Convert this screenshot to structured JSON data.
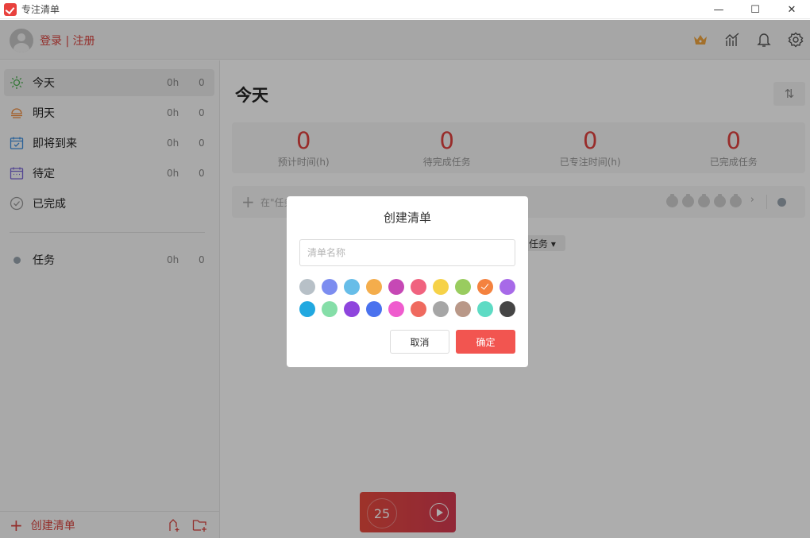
{
  "app": {
    "title": "专注清单"
  },
  "window_controls": {
    "minimize": "—",
    "maximize": "☐",
    "close": "✕"
  },
  "header": {
    "login": "登录",
    "separator": "|",
    "register": "注册"
  },
  "sidebar": {
    "items": [
      {
        "label": "今天",
        "hours": "0h",
        "count": "0",
        "icon": "sun-icon",
        "color": "#4caf50"
      },
      {
        "label": "明天",
        "hours": "0h",
        "count": "0",
        "icon": "sunset-icon",
        "color": "#f08a3a"
      },
      {
        "label": "即将到来",
        "hours": "0h",
        "count": "0",
        "icon": "calendar-check-icon",
        "color": "#3f8fe0"
      },
      {
        "label": "待定",
        "hours": "0h",
        "count": "0",
        "icon": "calendar-icon",
        "color": "#7b68d8"
      },
      {
        "label": "已完成",
        "hours": "",
        "count": "",
        "icon": "check-circle-icon",
        "color": "#999999"
      }
    ],
    "lists": [
      {
        "label": "任务",
        "hours": "0h",
        "count": "0",
        "color": "#98a4ae"
      }
    ],
    "footer": {
      "create_list": "创建清单"
    }
  },
  "main": {
    "title": "今天",
    "sort_icon": "⇅",
    "stats": [
      {
        "value": "0",
        "label": "预计时间(h)"
      },
      {
        "value": "0",
        "label": "待完成任务"
      },
      {
        "value": "0",
        "label": "已专注时间(h)"
      },
      {
        "value": "0",
        "label": "已完成任务"
      }
    ],
    "add_task_placeholder": "在\"任务",
    "filter_chip": "任务 ▾",
    "timer": {
      "minutes": "25"
    }
  },
  "modal": {
    "title": "创建清单",
    "name_placeholder": "清单名称",
    "name_value": "",
    "colors": [
      "#b7c0c7",
      "#7c8df0",
      "#67bde8",
      "#f4ad4c",
      "#c648b5",
      "#f0637f",
      "#f6d248",
      "#99cc5f",
      "#f4823f",
      "#a76ae8",
      "#21a8e0",
      "#85dea8",
      "#8e45dd",
      "#4a72ee",
      "#ef5cce",
      "#ef6a5f",
      "#a6a6a6",
      "#b99888",
      "#5edbc4",
      "#454545"
    ],
    "selected_index": 8,
    "cancel_label": "取消",
    "ok_label": "确定"
  }
}
